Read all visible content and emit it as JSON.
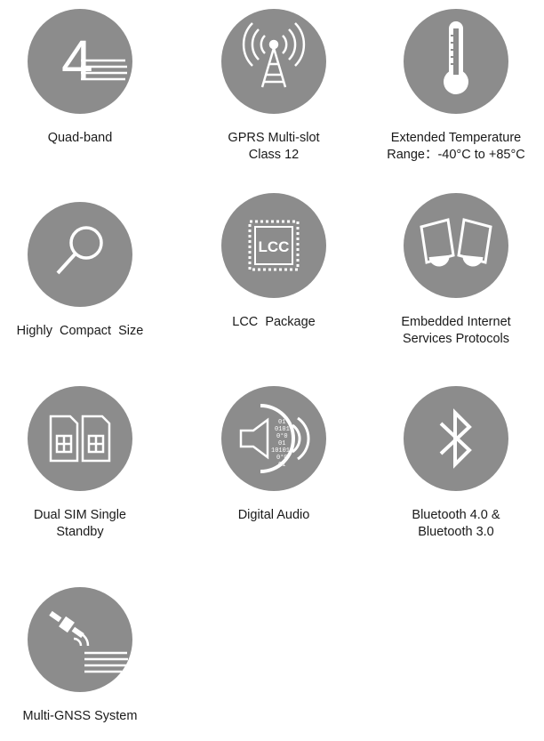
{
  "features": [
    {
      "icon": "quad-band-4-icon",
      "lines": [
        "Quad-band"
      ]
    },
    {
      "icon": "antenna-tower-icon",
      "lines": [
        "GPRS Multi-slot",
        "Class 12"
      ]
    },
    {
      "icon": "thermometer-icon",
      "lines": [
        "Extended Temperature",
        "Range：-40°C to +85°C"
      ]
    },
    {
      "icon": "magnifier-icon",
      "lines": [
        "Highly  Compact  Size"
      ]
    },
    {
      "icon": "lcc-chip-icon",
      "icon_text": "LCC",
      "lines": [
        "LCC  Package"
      ]
    },
    {
      "icon": "internet-protocols-icon",
      "lines": [
        "Embedded Internet",
        "Services Protocols"
      ]
    },
    {
      "icon": "dual-sim-icon",
      "lines": [
        "Dual SIM Single",
        "Standby"
      ]
    },
    {
      "icon": "digital-audio-icon",
      "icon_text": [
        "01",
        "0101",
        "0°0",
        "01",
        "10101",
        "0°0",
        "01"
      ],
      "lines": [
        "Digital Audio"
      ]
    },
    {
      "icon": "bluetooth-icon",
      "lines": [
        "Bluetooth 4.0 &",
        "Bluetooth 3.0"
      ]
    },
    {
      "icon": "satellite-gnss-icon",
      "lines": [
        "Multi-GNSS System"
      ]
    }
  ],
  "colors": {
    "circle": "#8c8c8c",
    "glyph": "#ffffff",
    "text": "#1a1a1a"
  }
}
